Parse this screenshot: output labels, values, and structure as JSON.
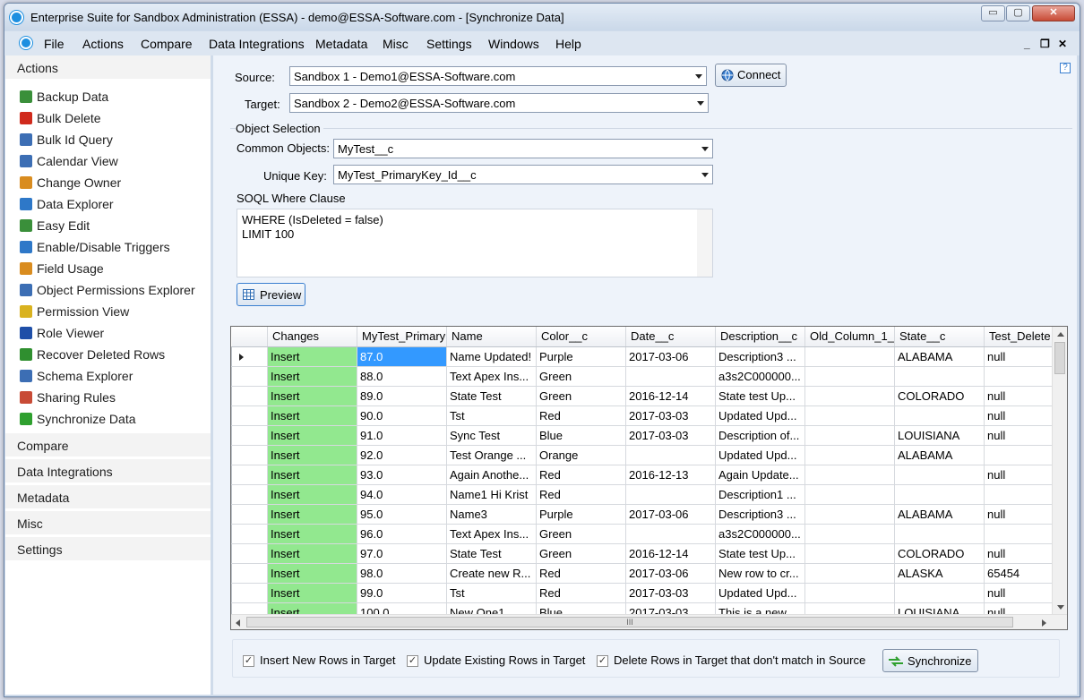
{
  "window": {
    "title": "Enterprise Suite for Sandbox Administration (ESSA) - demo@ESSA-Software.com - [Synchronize Data]",
    "min": "▭",
    "max": "▢",
    "close": "✕"
  },
  "menu": {
    "items": [
      "File",
      "Actions",
      "Compare",
      "Data Integrations",
      "Metadata",
      "Misc",
      "Settings",
      "Windows",
      "Help"
    ],
    "mdi_min": "_",
    "mdi_restore": "❐",
    "mdi_close": "✕"
  },
  "sidebar": {
    "actions_header": "Actions",
    "items": [
      {
        "label": "Backup Data",
        "icon": "backup-icon",
        "color": "#3a8f3a"
      },
      {
        "label": "Bulk Delete",
        "icon": "delete-x-icon",
        "color": "#d02a1c"
      },
      {
        "label": "Bulk Id Query",
        "icon": "query-icon",
        "color": "#3c6eb4"
      },
      {
        "label": "Calendar View",
        "icon": "calendar-icon",
        "color": "#3c6eb4"
      },
      {
        "label": "Change Owner",
        "icon": "owner-icon",
        "color": "#d98c1f"
      },
      {
        "label": "Data Explorer",
        "icon": "globe-icon",
        "color": "#2e78c8"
      },
      {
        "label": "Easy Edit",
        "icon": "edit-icon",
        "color": "#3a8f3a"
      },
      {
        "label": "Enable/Disable Triggers",
        "icon": "triggers-icon",
        "color": "#2e78c8"
      },
      {
        "label": "Field Usage",
        "icon": "usage-icon",
        "color": "#d98c1f"
      },
      {
        "label": "Object Permissions Explorer",
        "icon": "permissions-icon",
        "color": "#3c6eb4"
      },
      {
        "label": "Permission View",
        "icon": "permission-view-icon",
        "color": "#d9b21f"
      },
      {
        "label": "Role Viewer",
        "icon": "role-icon",
        "color": "#1f4fa8"
      },
      {
        "label": "Recover Deleted Rows",
        "icon": "recover-icon",
        "color": "#2f8f2f"
      },
      {
        "label": "Schema Explorer",
        "icon": "schema-icon",
        "color": "#3c6eb4"
      },
      {
        "label": "Sharing Rules",
        "icon": "sharing-icon",
        "color": "#c84b36"
      },
      {
        "label": "Synchronize Data",
        "icon": "sync-icon",
        "color": "#2fa02f"
      }
    ],
    "sections": [
      "Compare",
      "Data Integrations",
      "Metadata",
      "Misc",
      "Settings"
    ]
  },
  "form": {
    "source_label": "Source:",
    "source_value": "Sandbox 1 - Demo1@ESSA-Software.com",
    "target_label": "Target:",
    "target_value": "Sandbox 2 - Demo2@ESSA-Software.com",
    "connect_label": "Connect",
    "object_selection": "Object Selection",
    "common_label": "Common Objects:",
    "common_value": "MyTest__c",
    "unique_label": "Unique Key:",
    "unique_value": "MyTest_PrimaryKey_Id__c",
    "soql_label": "SOQL Where Clause",
    "soql_line1": "WHERE (IsDeleted = false)",
    "soql_line2": "LIMIT 100",
    "preview_label": "Preview",
    "help": "?"
  },
  "grid": {
    "columns": [
      "Changes",
      "MyTest_Primary",
      "Name",
      "Color__c",
      "Date__c",
      "Description__c",
      "Old_Column_1_",
      "State__c",
      "Test_Delete"
    ],
    "rows": [
      [
        "Insert",
        "87.0",
        "Name Updated!",
        "Purple",
        "2017-03-06",
        "Description3 ...",
        "",
        "ALABAMA",
        "null"
      ],
      [
        "Insert",
        "88.0",
        "Text Apex Ins...",
        "Green",
        "",
        "a3s2C000000...",
        "",
        "",
        ""
      ],
      [
        "Insert",
        "89.0",
        "State Test",
        "Green",
        "2016-12-14",
        "State test Up...",
        "",
        "COLORADO",
        "null"
      ],
      [
        "Insert",
        "90.0",
        "Tst",
        "Red",
        "2017-03-03",
        "Updated Upd...",
        "",
        "",
        "null"
      ],
      [
        "Insert",
        "91.0",
        "Sync Test",
        "Blue",
        "2017-03-03",
        "Description of...",
        "",
        "LOUISIANA",
        "null"
      ],
      [
        "Insert",
        "92.0",
        "Test Orange ...",
        "Orange",
        "",
        "Updated Upd...",
        "",
        "ALABAMA",
        ""
      ],
      [
        "Insert",
        "93.0",
        "Again Anothe...",
        "Red",
        "2016-12-13",
        "Again Update...",
        "",
        "",
        "null"
      ],
      [
        "Insert",
        "94.0",
        "Name1 Hi Krist",
        "Red",
        "",
        "Description1 ...",
        "",
        "",
        ""
      ],
      [
        "Insert",
        "95.0",
        "Name3",
        "Purple",
        "2017-03-06",
        "Description3 ...",
        "",
        "ALABAMA",
        "null"
      ],
      [
        "Insert",
        "96.0",
        "Text Apex Ins...",
        "Green",
        "",
        "a3s2C000000...",
        "",
        "",
        ""
      ],
      [
        "Insert",
        "97.0",
        "State Test",
        "Green",
        "2016-12-14",
        "State test Up...",
        "",
        "COLORADO",
        "null"
      ],
      [
        "Insert",
        "98.0",
        "Create new R...",
        "Red",
        "2017-03-06",
        "New row to cr...",
        "",
        "ALASKA",
        "65454"
      ],
      [
        "Insert",
        "99.0",
        "Tst",
        "Red",
        "2017-03-03",
        "Updated Upd...",
        "",
        "",
        "null"
      ],
      [
        "Insert",
        "100.0",
        "New One1",
        "Blue",
        "2017-03-03",
        "This is a new...",
        "",
        "LOUISIANA",
        "null"
      ]
    ],
    "hscroll_grip": "III"
  },
  "footer": {
    "insert_label": "Insert New Rows in Target",
    "update_label": "Update Existing Rows in Target",
    "delete_label": "Delete Rows in Target that don't match in Source",
    "sync_label": "Synchronize",
    "check": "✓"
  }
}
